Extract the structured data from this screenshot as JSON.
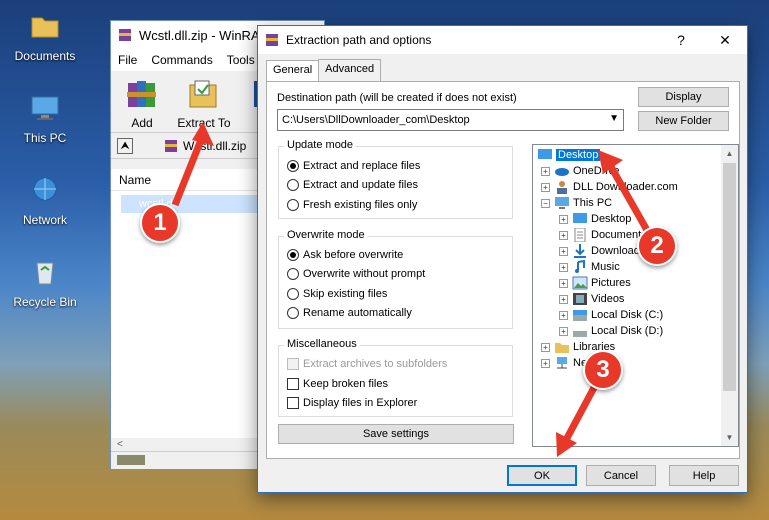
{
  "desktop": {
    "icons": [
      {
        "label": "Documents"
      },
      {
        "label": "This PC"
      },
      {
        "label": "Network"
      },
      {
        "label": "Recycle Bin"
      }
    ]
  },
  "winrar": {
    "title": "Wcstl.dll.zip - WinRAR",
    "menu": [
      "File",
      "Commands",
      "Tools"
    ],
    "toolbar": {
      "add": "Add",
      "extract_to": "Extract To"
    },
    "path": "Wcstl.dll.zip",
    "list_header": "Name",
    "list_item": "wcstl.dll"
  },
  "dialog": {
    "title": "Extraction path and options",
    "help": "?",
    "close": "✕",
    "tabs": [
      "General",
      "Advanced"
    ],
    "dest_label": "Destination path (will be created if does not exist)",
    "dest_value": "C:\\Users\\DllDownloader_com\\Desktop",
    "display_btn": "Display",
    "new_folder_btn": "New Folder",
    "update_mode": {
      "title": "Update mode",
      "options": [
        "Extract and replace files",
        "Extract and update files",
        "Fresh existing files only"
      ],
      "selected": 0
    },
    "overwrite_mode": {
      "title": "Overwrite mode",
      "options": [
        "Ask before overwrite",
        "Overwrite without prompt",
        "Skip existing files",
        "Rename automatically"
      ],
      "selected": 0
    },
    "misc": {
      "title": "Miscellaneous",
      "options": [
        "Extract archives to subfolders",
        "Keep broken files",
        "Display files in Explorer"
      ]
    },
    "save_settings": "Save settings",
    "tree": [
      {
        "label": "Desktop",
        "selected": true
      },
      {
        "label": "OneDrive"
      },
      {
        "label": "DLL Downloader.com"
      },
      {
        "label": "This PC"
      },
      {
        "label": "Desktop"
      },
      {
        "label": "Documents"
      },
      {
        "label": "Downloads"
      },
      {
        "label": "Music"
      },
      {
        "label": "Pictures"
      },
      {
        "label": "Videos"
      },
      {
        "label": "Local Disk (C:)"
      },
      {
        "label": "Local Disk (D:)"
      },
      {
        "label": "Libraries"
      },
      {
        "label": "Network"
      }
    ],
    "ok": "OK",
    "cancel": "Cancel",
    "help_btn": "Help"
  },
  "callouts": [
    "1",
    "2",
    "3"
  ],
  "colors": {
    "accent": "#0078d7",
    "callout": "#e8382a"
  }
}
